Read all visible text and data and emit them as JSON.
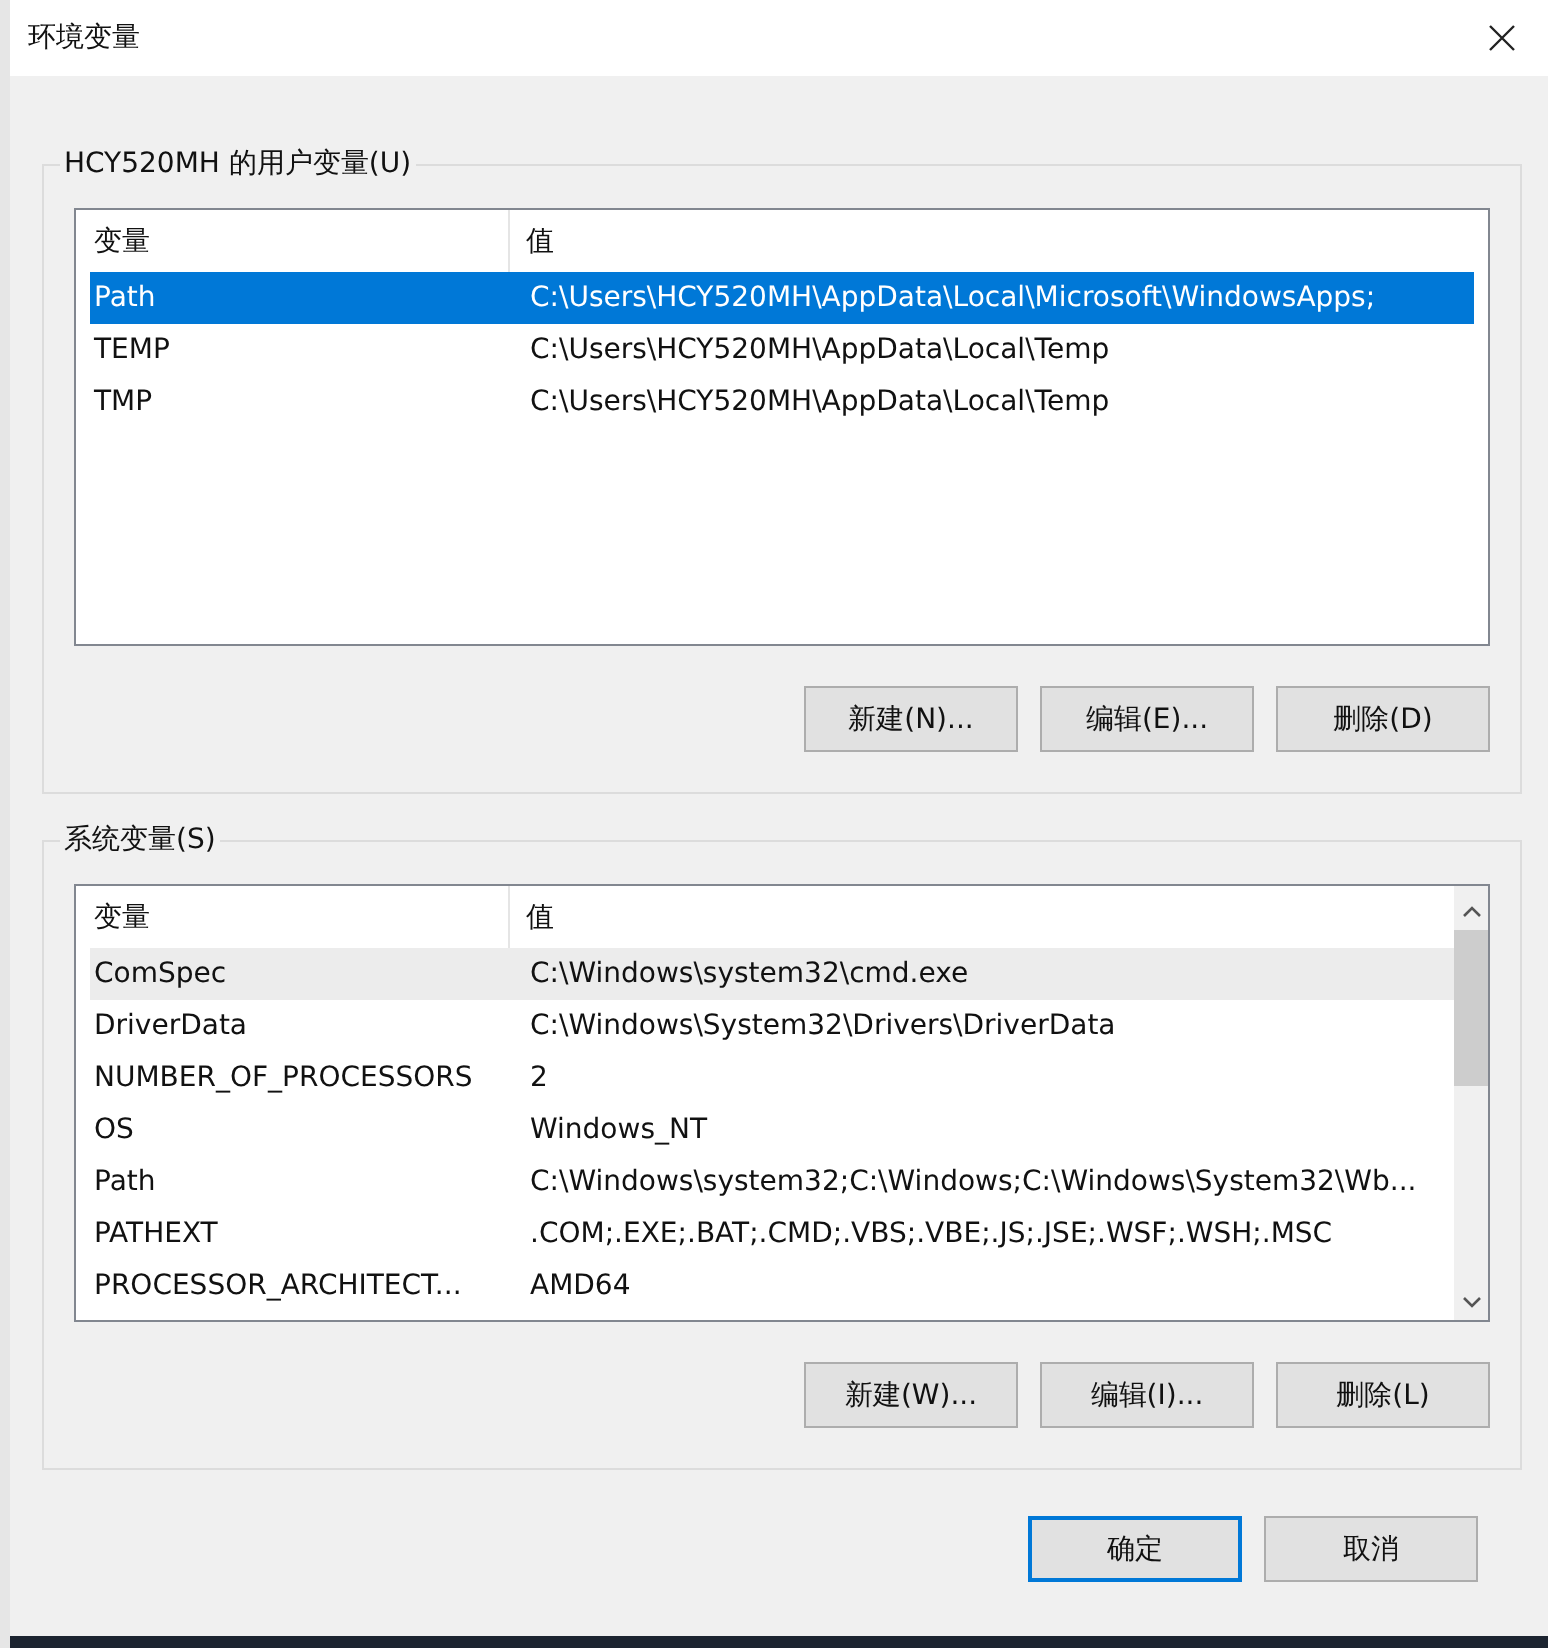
{
  "window": {
    "title": "环境变量"
  },
  "groups": [
    {
      "title": "HCY520MH 的用户变量(U)",
      "focused": true,
      "scrollbar": false,
      "columns": [
        "变量",
        "值"
      ],
      "rows": [
        {
          "cells": [
            "Path",
            "C:\\Users\\HCY520MH\\AppData\\Local\\Microsoft\\WindowsApps;"
          ],
          "selected": true
        },
        {
          "cells": [
            "TEMP",
            "C:\\Users\\HCY520MH\\AppData\\Local\\Temp"
          ],
          "selected": false
        },
        {
          "cells": [
            "TMP",
            "C:\\Users\\HCY520MH\\AppData\\Local\\Temp"
          ],
          "selected": false
        }
      ],
      "buttons": [
        "新建(N)...",
        "编辑(E)...",
        "删除(D)"
      ]
    },
    {
      "title": "系统变量(S)",
      "focused": false,
      "scrollbar": true,
      "columns": [
        "变量",
        "值"
      ],
      "rows": [
        {
          "cells": [
            "ComSpec",
            "C:\\Windows\\system32\\cmd.exe"
          ],
          "selected": true
        },
        {
          "cells": [
            "DriverData",
            "C:\\Windows\\System32\\Drivers\\DriverData"
          ],
          "selected": false
        },
        {
          "cells": [
            "NUMBER_OF_PROCESSORS",
            "2"
          ],
          "selected": false
        },
        {
          "cells": [
            "OS",
            "Windows_NT"
          ],
          "selected": false
        },
        {
          "cells": [
            "Path",
            "C:\\Windows\\system32;C:\\Windows;C:\\Windows\\System32\\Wb..."
          ],
          "selected": false
        },
        {
          "cells": [
            "PATHEXT",
            ".COM;.EXE;.BAT;.CMD;.VBS;.VBE;.JS;.JSE;.WSF;.WSH;.MSC"
          ],
          "selected": false
        },
        {
          "cells": [
            "PROCESSOR_ARCHITECT...",
            "AMD64"
          ],
          "selected": false
        }
      ],
      "buttons": [
        "新建(W)...",
        "编辑(I)...",
        "删除(L)"
      ]
    }
  ],
  "footer_buttons": [
    {
      "label": "确定",
      "default": true
    },
    {
      "label": "取消",
      "default": false
    }
  ]
}
